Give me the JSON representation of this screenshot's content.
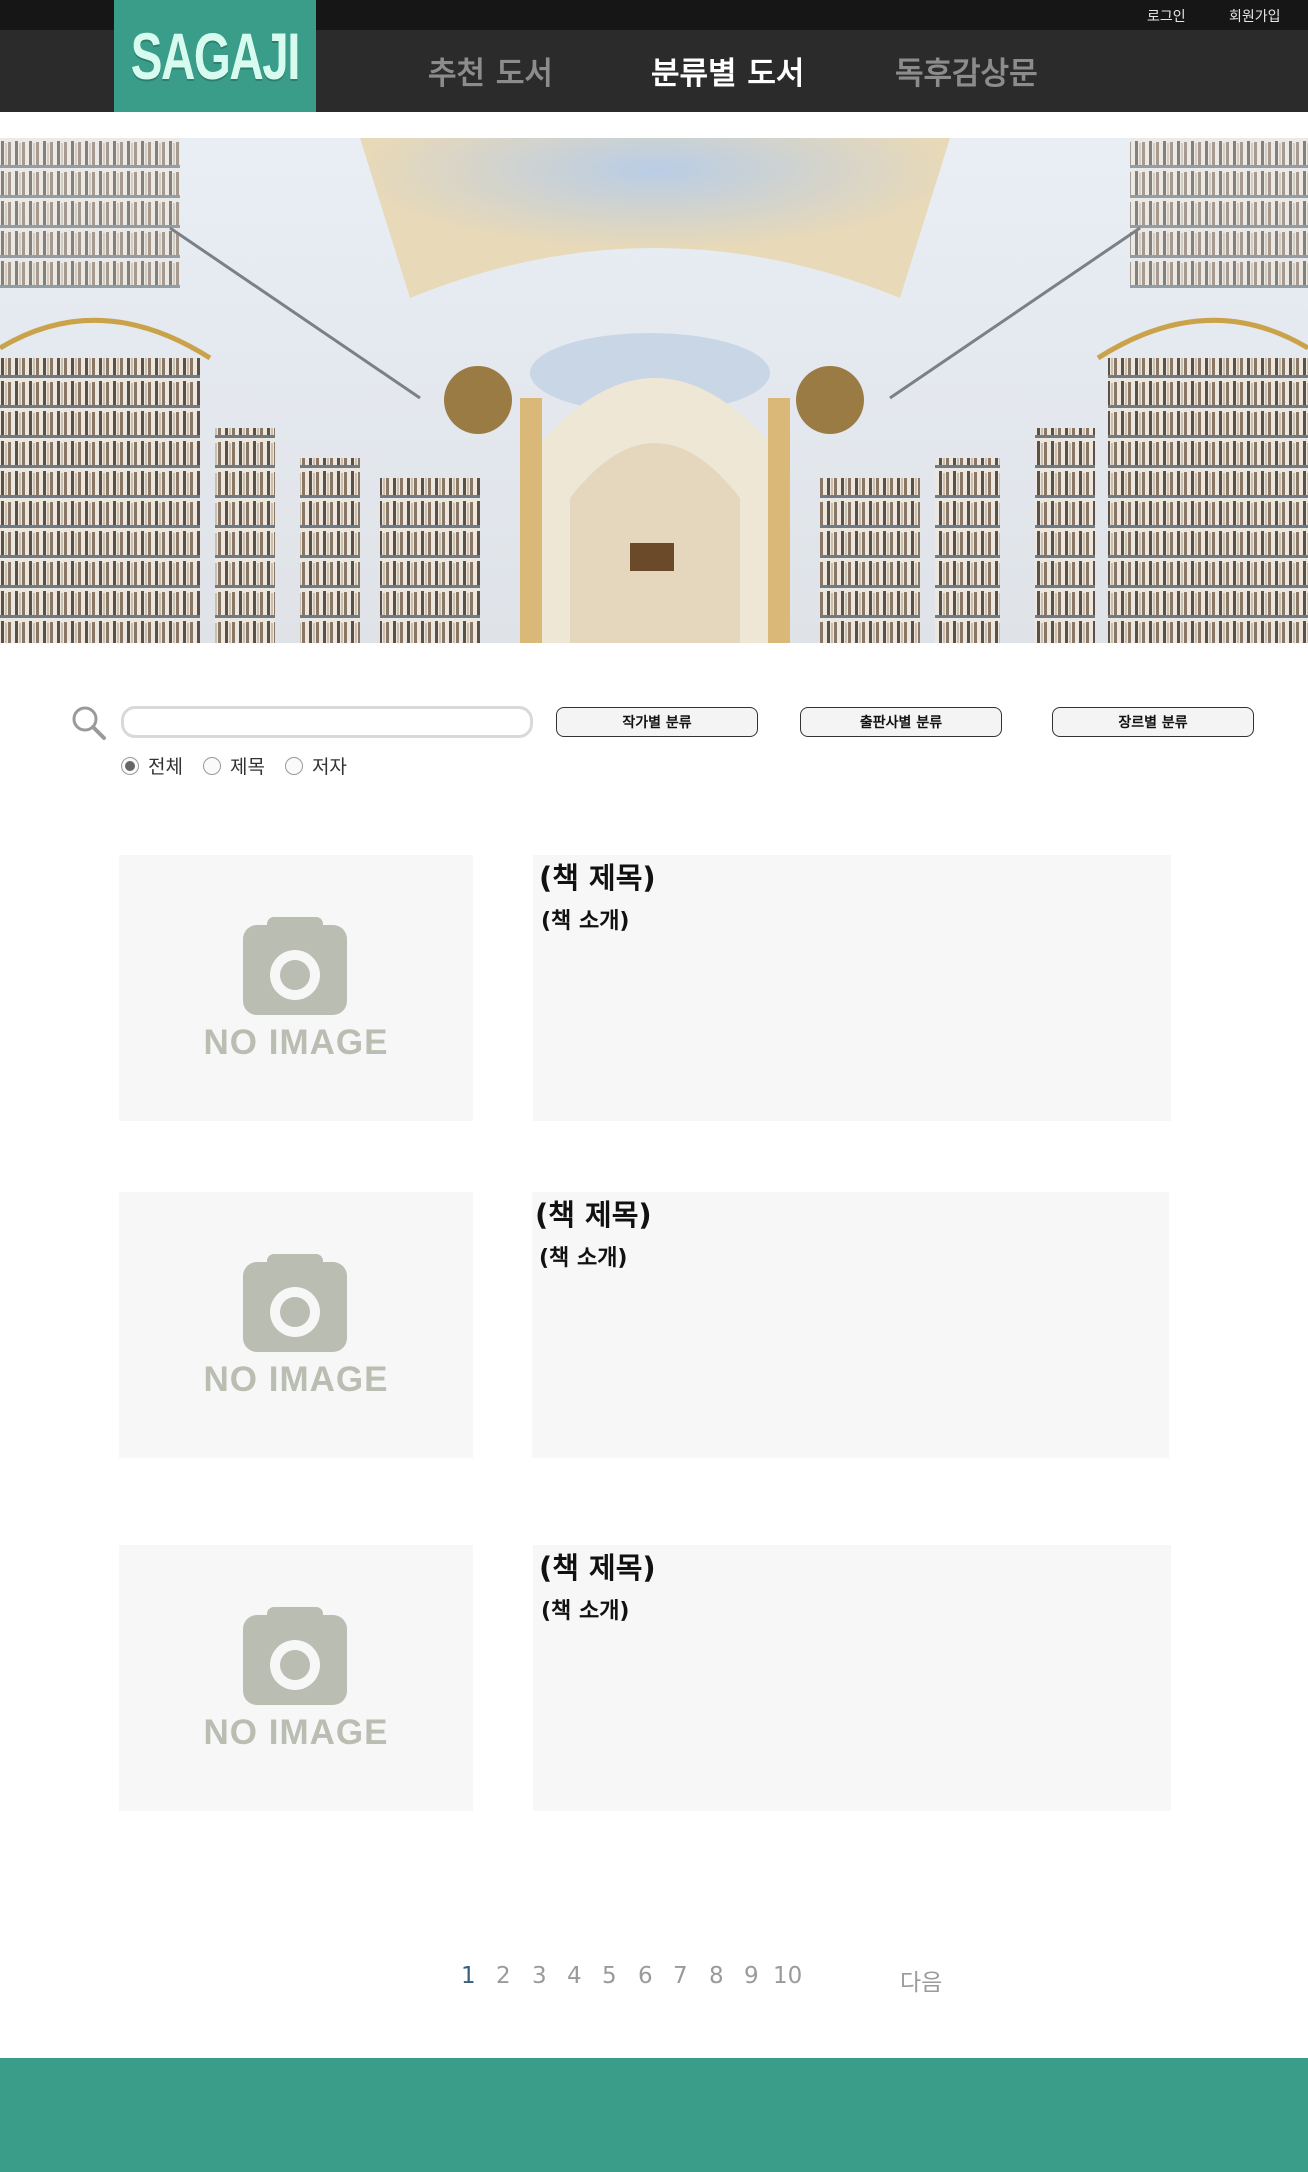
{
  "header": {
    "logo_text": "SAGAJI",
    "top_links": [
      "로그인",
      "회원가입"
    ],
    "nav": [
      {
        "label": "추천 도서",
        "active": false
      },
      {
        "label": "분류별 도서",
        "active": true
      },
      {
        "label": "독후감상문",
        "active": false
      }
    ]
  },
  "search": {
    "value": "",
    "placeholder": "",
    "category_buttons": [
      "작가별 분류",
      "출판사별 분류",
      "장르별 분류"
    ],
    "filters": [
      {
        "label": "전체",
        "checked": true
      },
      {
        "label": "제목",
        "checked": false
      },
      {
        "label": "저자",
        "checked": false
      }
    ]
  },
  "books": [
    {
      "image_text": "NO IMAGE",
      "title": "(책 제목)",
      "description": "(책 소개)"
    },
    {
      "image_text": "NO IMAGE",
      "title": "(책 제목)",
      "description": "(책 소개)"
    },
    {
      "image_text": "NO IMAGE",
      "title": "(책 제목)",
      "description": "(책 소개)"
    }
  ],
  "pagination": {
    "pages": [
      "1",
      "2",
      "3",
      "4",
      "5",
      "6",
      "7",
      "8",
      "9",
      "10"
    ],
    "current": "1",
    "next_label": "다음"
  },
  "colors": {
    "brand": "#3a9d8a",
    "topbar": "#161616",
    "navbar": "#2b2b2b",
    "placeholder_bg": "#f7f7f7",
    "camera_gray": "#babdb1"
  },
  "icons": [
    "search-icon",
    "camera-icon"
  ]
}
